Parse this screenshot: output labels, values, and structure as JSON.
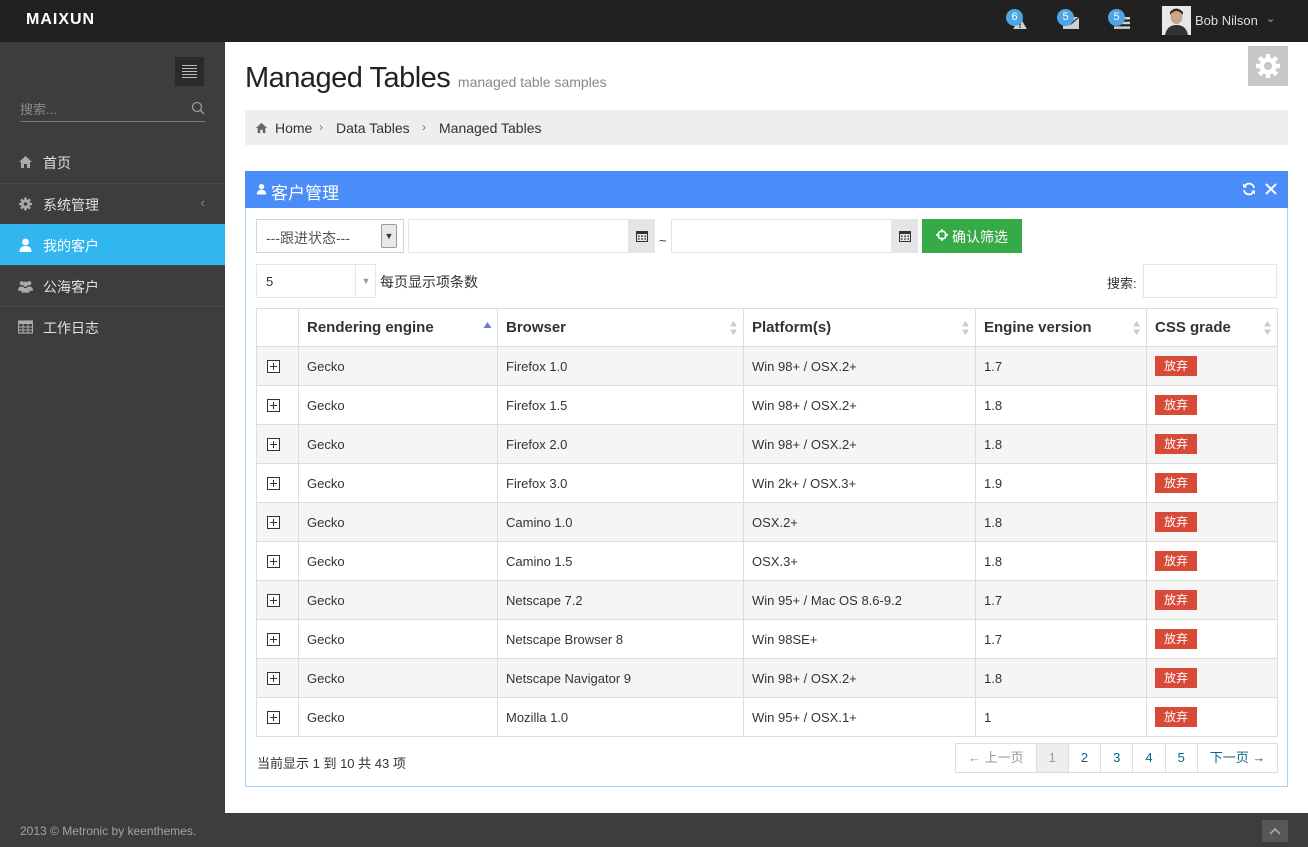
{
  "header": {
    "logo": "MAIXUN",
    "notifications": [
      {
        "icon": "warning-icon",
        "count": "6"
      },
      {
        "icon": "envelope-icon",
        "count": "5"
      },
      {
        "icon": "tasks-icon",
        "count": "5"
      }
    ],
    "user": {
      "name": "Bob Nilson"
    }
  },
  "sidebar": {
    "search_placeholder": "搜索...",
    "items": [
      {
        "label": "首页",
        "icon": "home-icon"
      },
      {
        "label": "系统管理",
        "icon": "cog-icon"
      },
      {
        "label": "我的客户",
        "icon": "user-icon"
      },
      {
        "label": "公海客户",
        "icon": "group-icon"
      },
      {
        "label": "工作日志",
        "icon": "table-icon"
      }
    ]
  },
  "page": {
    "title": "Managed Tables",
    "subtitle": "managed table samples",
    "breadcrumb": [
      "Home",
      "Data Tables",
      "Managed Tables"
    ]
  },
  "portlet": {
    "title": "客户管理",
    "filter_status": "---跟进状态---",
    "date_separator": "~",
    "filter_button": "确认筛选",
    "page_length": "5",
    "page_length_label": "每页显示项条数",
    "search_label": "搜索:"
  },
  "table": {
    "columns": [
      "Rendering engine",
      "Browser",
      "Platform(s)",
      "Engine version",
      "CSS grade"
    ],
    "rows": [
      {
        "engine": "Gecko",
        "browser": "Firefox 1.0",
        "platform": "Win 98+ / OSX.2+",
        "version": "1.7",
        "grade": "放弃"
      },
      {
        "engine": "Gecko",
        "browser": "Firefox 1.5",
        "platform": "Win 98+ / OSX.2+",
        "version": "1.8",
        "grade": "放弃"
      },
      {
        "engine": "Gecko",
        "browser": "Firefox 2.0",
        "platform": "Win 98+ / OSX.2+",
        "version": "1.8",
        "grade": "放弃"
      },
      {
        "engine": "Gecko",
        "browser": "Firefox 3.0",
        "platform": "Win 2k+ / OSX.3+",
        "version": "1.9",
        "grade": "放弃"
      },
      {
        "engine": "Gecko",
        "browser": "Camino 1.0",
        "platform": "OSX.2+",
        "version": "1.8",
        "grade": "放弃"
      },
      {
        "engine": "Gecko",
        "browser": "Camino 1.5",
        "platform": "OSX.3+",
        "version": "1.8",
        "grade": "放弃"
      },
      {
        "engine": "Gecko",
        "browser": "Netscape 7.2",
        "platform": "Win 95+ / Mac OS 8.6-9.2",
        "version": "1.7",
        "grade": "放弃"
      },
      {
        "engine": "Gecko",
        "browser": "Netscape Browser 8",
        "platform": "Win 98SE+",
        "version": "1.7",
        "grade": "放弃"
      },
      {
        "engine": "Gecko",
        "browser": "Netscape Navigator 9",
        "platform": "Win 98+ / OSX.2+",
        "version": "1.8",
        "grade": "放弃"
      },
      {
        "engine": "Gecko",
        "browser": "Mozilla 1.0",
        "platform": "Win 95+ / OSX.1+",
        "version": "1",
        "grade": "放弃"
      }
    ],
    "info": "当前显示 1 到 10 共 43 项",
    "pagination": {
      "prev": "← 上一页",
      "pages": [
        "1",
        "2",
        "3",
        "4",
        "5"
      ],
      "current": "1",
      "next": "下一页 →"
    }
  },
  "footer": {
    "text": "2013 © Metronic by keenthemes."
  },
  "colors": {
    "header": "#212121",
    "sidebar": "#3d3d3d",
    "active": "#32b6f0",
    "portlet": "#4b8df8",
    "success": "#35aa47",
    "danger": "#d84a38"
  }
}
